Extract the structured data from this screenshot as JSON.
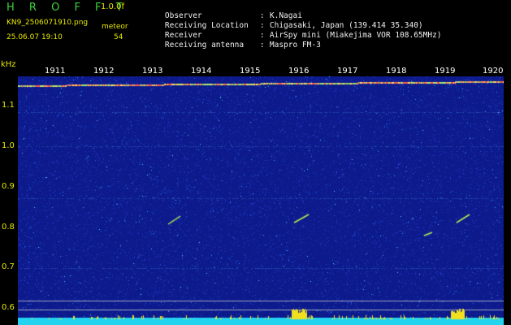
{
  "app": {
    "title": "H R O F F T",
    "version": "1.0.0f"
  },
  "file": {
    "name": "KN9_2506071910.png",
    "datetime": "25.06.07 19:10"
  },
  "meteor": {
    "label": "meteor",
    "count": "54"
  },
  "info": [
    {
      "key": "Observer",
      "value": "K.Nagai"
    },
    {
      "key": "Receiving Location",
      "value": "Chigasaki, Japan (139.414 35.340)"
    },
    {
      "key": "Receiver",
      "value": "AirSpy mini (Miakejima VOR 108.65MHz)"
    },
    {
      "key": "Receiving antenna",
      "value": "Maspro FM-3"
    }
  ],
  "axis": {
    "y_unit": "kHz",
    "y_ticks": [
      "1.1",
      "1.0",
      "0.9",
      "0.8",
      "0.7",
      "0.6"
    ],
    "x_ticks": [
      "1911",
      "1912",
      "1913",
      "1914",
      "1915",
      "1916",
      "1917",
      "1918",
      "1919",
      "1920"
    ]
  },
  "colors": {
    "background": "#0c1a8c",
    "label": "#e6e600",
    "title": "#3cd23c",
    "baseline": "#22d4f0"
  }
}
